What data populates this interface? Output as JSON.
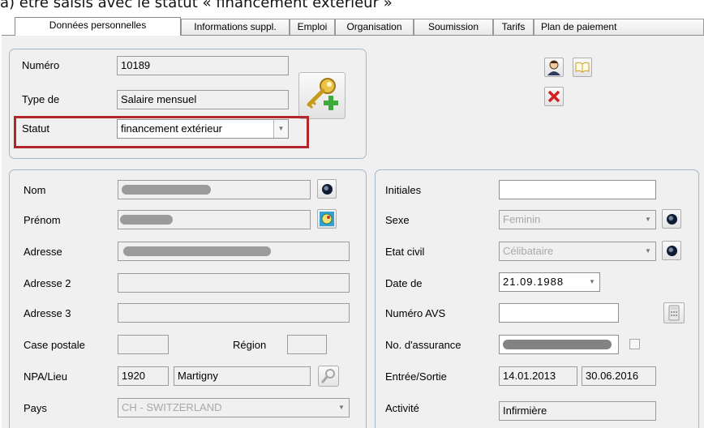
{
  "caption": "a) être saisis avec le statut « financement extérieur »",
  "tabs": [
    {
      "label": "Données personnelles"
    },
    {
      "label": "Informations suppl."
    },
    {
      "label": "Emploi"
    },
    {
      "label": "Organisation"
    },
    {
      "label": "Soumission"
    },
    {
      "label": "Tarifs"
    },
    {
      "label": "Plan de paiement"
    }
  ],
  "top_panel": {
    "numero_label": "Numéro",
    "numero_value": "10189",
    "type_label": "Type de",
    "type_value": "Salaire mensuel",
    "statut_label": "Statut",
    "statut_value": "financement extérieur",
    "icons": [
      "key-add-icon",
      "person-icon",
      "book-icon",
      "delete-x-icon"
    ]
  },
  "left_panel": {
    "nom_label": "Nom",
    "prenom_label": "Prénom",
    "adresse_label": "Adresse",
    "adresse2_label": "Adresse 2",
    "adresse3_label": "Adresse 3",
    "case_postale_label": "Case postale",
    "region_label": "Région",
    "npa_label": "NPA/Lieu",
    "npa_value": "1920",
    "lieu_value": "Martigny",
    "pays_label": "Pays",
    "pays_value": "CH - SWITZERLAND"
  },
  "right_panel": {
    "initiales_label": "Initiales",
    "sexe_label": "Sexe",
    "sexe_value": "Feminin",
    "etat_civil_label": "Etat civil",
    "etat_civil_value": "Célibataire",
    "date_label": "Date de",
    "date_value": "21.09.1988",
    "avs_label": "Numéro AVS",
    "assurance_label": "No. d'assurance",
    "entree_label": "Entrée/Sortie",
    "entree_value": "14.01.2013",
    "sortie_value": "30.06.2016",
    "activite_label": "Activité",
    "activite_value": "Infirmière"
  },
  "colors": {
    "highlight_border": "#b1272c",
    "panel_border": "#a9b6c8",
    "delete_red": "#d21f1f"
  }
}
